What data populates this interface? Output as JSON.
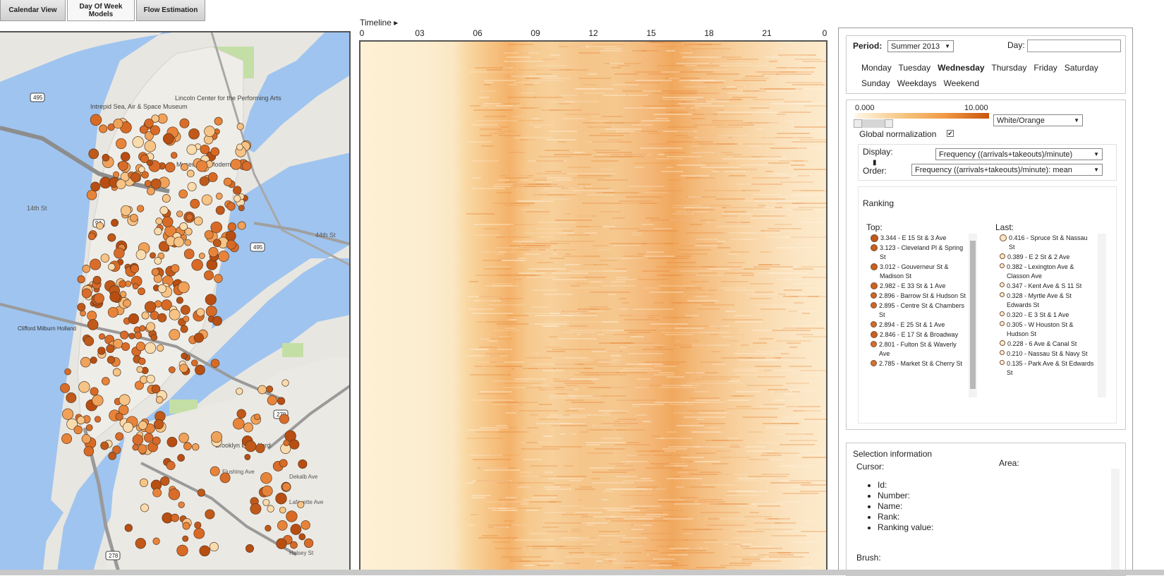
{
  "tabs": [
    {
      "label": "Calendar View"
    },
    {
      "label": "Day Of Week Models"
    },
    {
      "label": "Flow Estimation"
    }
  ],
  "map": {
    "labels": {
      "intrepid": "Intrepid Sea, Air & Space Museum",
      "lincoln": "Lincoln Center for the Performing Arts",
      "moma": "Museum of Modern Art",
      "brooklyn_navy_yard": "Brooklyn Navy Yard",
      "clifford": "Clifford Milburn Holland",
      "w14": "14th St",
      "e44": "44th St",
      "flushing": "Flushing Ave",
      "dekalb": "Dekalb Ave",
      "lafayette": "Lafayette Ave",
      "halsey": "Halsey St",
      "hwy_495": "495",
      "hwy_278": "278",
      "hwy_9a": "9A"
    }
  },
  "heatmap": {
    "timeline_label": "Timeline ▸",
    "hour_ticks": [
      "0",
      "03",
      "06",
      "09",
      "12",
      "15",
      "18",
      "21",
      "0"
    ]
  },
  "period": {
    "label": "Period:",
    "selected": "Summer 2013",
    "day_label": "Day:",
    "day_value": "",
    "days": [
      "Monday",
      "Tuesday",
      "Wednesday",
      "Thursday",
      "Friday",
      "Saturday",
      "Sunday",
      "Weekdays",
      "Weekend"
    ],
    "active_day": "Wednesday"
  },
  "scale": {
    "min": "0.000",
    "max": "10.000",
    "colormap": "White/Orange",
    "global_norm_label": "Global normalization",
    "global_norm_checked": true,
    "display_label": "Display:",
    "display_value": "Frequency ((arrivals+takeouts)/minute)",
    "order_label": "Order:",
    "order_value": "Frequency ((arrivals+takeouts)/minute): mean"
  },
  "ranking": {
    "title": "Ranking",
    "top_label": "Top:",
    "last_label": "Last:",
    "top": [
      {
        "text": "3.344 - E 15 St & 3 Ave"
      },
      {
        "text": "3.123 - Cleveland Pl & Spring St"
      },
      {
        "text": "3.012 - Gouverneur St & Madison St"
      },
      {
        "text": "2.982 - E 33 St & 1 Ave"
      },
      {
        "text": "2.896 - Barrow St & Hudson St"
      },
      {
        "text": "2.895 - Centre St & Chambers St"
      },
      {
        "text": "2.894 - E 25 St & 1 Ave"
      },
      {
        "text": "2.846 - E 17 St & Broadway"
      },
      {
        "text": "2.801 - Fulton St & Waverly Ave"
      },
      {
        "text": "2.785 - Market St & Cherry St"
      }
    ],
    "last": [
      {
        "text": "0.416 - Spruce St & Nassau St"
      },
      {
        "text": "0.389 - E 2 St & 2 Ave"
      },
      {
        "text": "0.382 - Lexington Ave & Classon Ave"
      },
      {
        "text": "0.347 - Kent Ave & S 11 St"
      },
      {
        "text": "0.328 - Myrtle Ave & St Edwards St"
      },
      {
        "text": "0.320 - E 3 St & 1 Ave"
      },
      {
        "text": "0.305 - W Houston St & Hudson St"
      },
      {
        "text": "0.228 - 6 Ave & Canal St"
      },
      {
        "text": "0.210 - Nassau St & Navy St"
      },
      {
        "text": "0.135 - Park Ave & St Edwards St"
      }
    ]
  },
  "selection": {
    "title": "Selection information",
    "cursor_label": "Cursor:",
    "area_label": "Area:",
    "fields": [
      "Id:",
      "Number:",
      "Name:",
      "Rank:",
      "Ranking value:"
    ],
    "brush_label": "Brush:"
  }
}
